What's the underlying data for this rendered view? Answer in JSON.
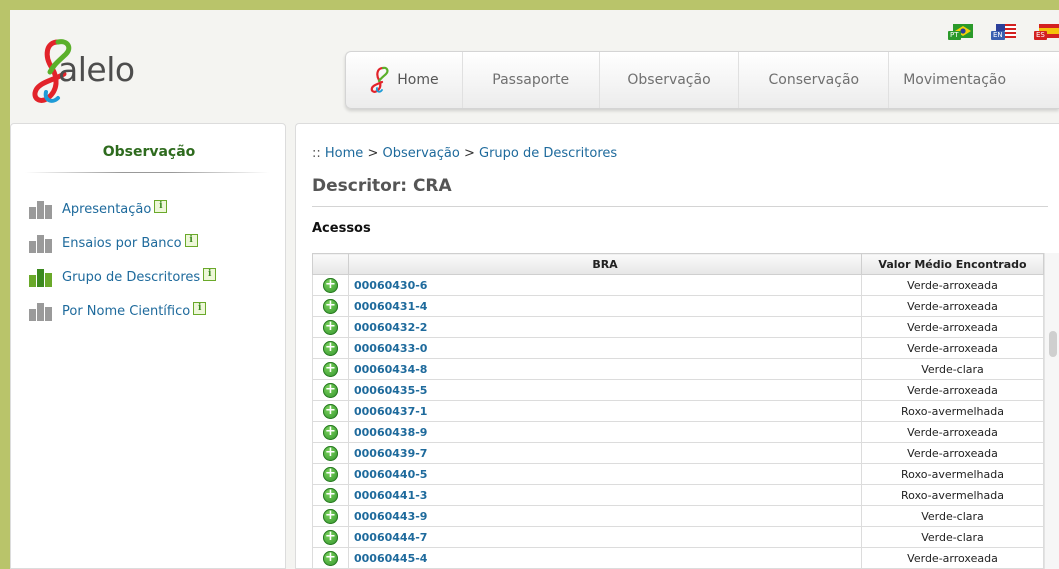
{
  "brand": {
    "name": "alelo"
  },
  "languages": [
    {
      "code": "PT",
      "color": "#2a9a2a"
    },
    {
      "code": "EN",
      "color": "#3a5fb0"
    },
    {
      "code": "ES",
      "color": "#d32020"
    }
  ],
  "nav": {
    "home": "Home",
    "items": [
      "Passaporte",
      "Observação",
      "Conservação",
      "Movimentação"
    ]
  },
  "sidebar": {
    "title": "Observação",
    "items": [
      {
        "label": "Apresentação",
        "active": false
      },
      {
        "label": "Ensaios por Banco",
        "active": false
      },
      {
        "label": "Grupo de Descritores",
        "active": true
      },
      {
        "label": "Por Nome Científico",
        "active": false
      }
    ],
    "info_glyph": "i"
  },
  "breadcrumb": {
    "prefix": "::",
    "home": "Home",
    "sep1": ">",
    "level1": "Observação",
    "sep2": ">",
    "level2": "Grupo de Descritores"
  },
  "main": {
    "title": "Descritor: CRA",
    "section": "Acessos"
  },
  "table": {
    "headers": [
      "BRA",
      "Valor Médio Encontrado"
    ],
    "expand_glyph": "+",
    "rows": [
      {
        "bra": "00060430-6",
        "value": "Verde-arroxeada"
      },
      {
        "bra": "00060431-4",
        "value": "Verde-arroxeada"
      },
      {
        "bra": "00060432-2",
        "value": "Verde-arroxeada"
      },
      {
        "bra": "00060433-0",
        "value": "Verde-arroxeada"
      },
      {
        "bra": "00060434-8",
        "value": "Verde-clara"
      },
      {
        "bra": "00060435-5",
        "value": "Verde-arroxeada"
      },
      {
        "bra": "00060437-1",
        "value": "Roxo-avermelhada"
      },
      {
        "bra": "00060438-9",
        "value": "Verde-arroxeada"
      },
      {
        "bra": "00060439-7",
        "value": "Verde-arroxeada"
      },
      {
        "bra": "00060440-5",
        "value": "Roxo-avermelhada"
      },
      {
        "bra": "00060441-3",
        "value": "Roxo-avermelhada"
      },
      {
        "bra": "00060443-9",
        "value": "Verde-clara"
      },
      {
        "bra": "00060444-7",
        "value": "Verde-clara"
      },
      {
        "bra": "00060445-4",
        "value": "Verde-arroxeada"
      }
    ]
  },
  "colors": {
    "frame": "#b9c46a",
    "link": "#1e6a9c",
    "sidebar_title": "#2e6b1e",
    "accent_green": "#6aa92a"
  }
}
